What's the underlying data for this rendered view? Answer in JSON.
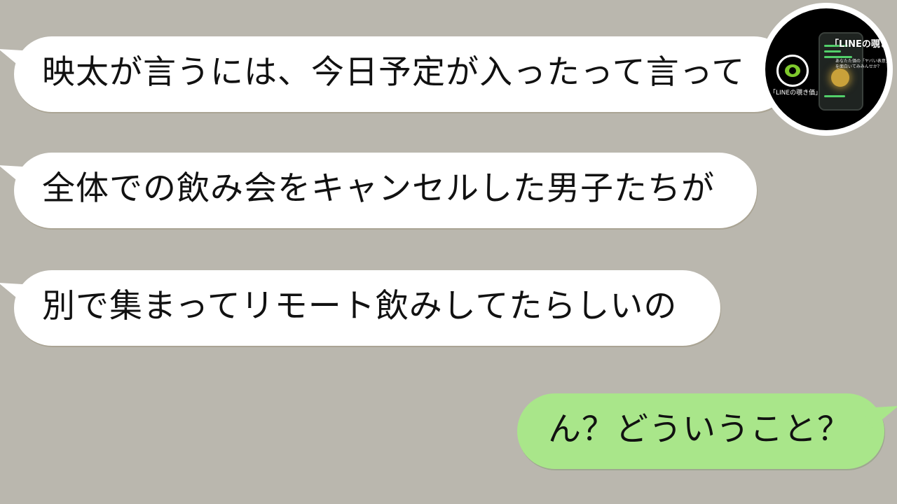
{
  "messages": [
    {
      "side": "incoming",
      "text": "映太が言うには、今日予定が入ったって言って"
    },
    {
      "side": "incoming",
      "text": "全体での飲み会をキャンセルした男子たちが"
    },
    {
      "side": "incoming",
      "text": "別で集まってリモート飲みしてたらしいの"
    },
    {
      "side": "outgoing",
      "text": "ん？どういうこと？"
    }
  ],
  "logo": {
    "title": "「LINEの覗き価",
    "small_label": "「LINEの覗き価」",
    "sub_line1": "あなたた価の「ヤバい表意」",
    "sub_line2": "を面白いてみみんせか？"
  },
  "colors": {
    "background": "#bab7ae",
    "incoming_bubble": "#ffffff",
    "outgoing_bubble": "#a9e68a",
    "logo_accent": "#7ec92c"
  }
}
